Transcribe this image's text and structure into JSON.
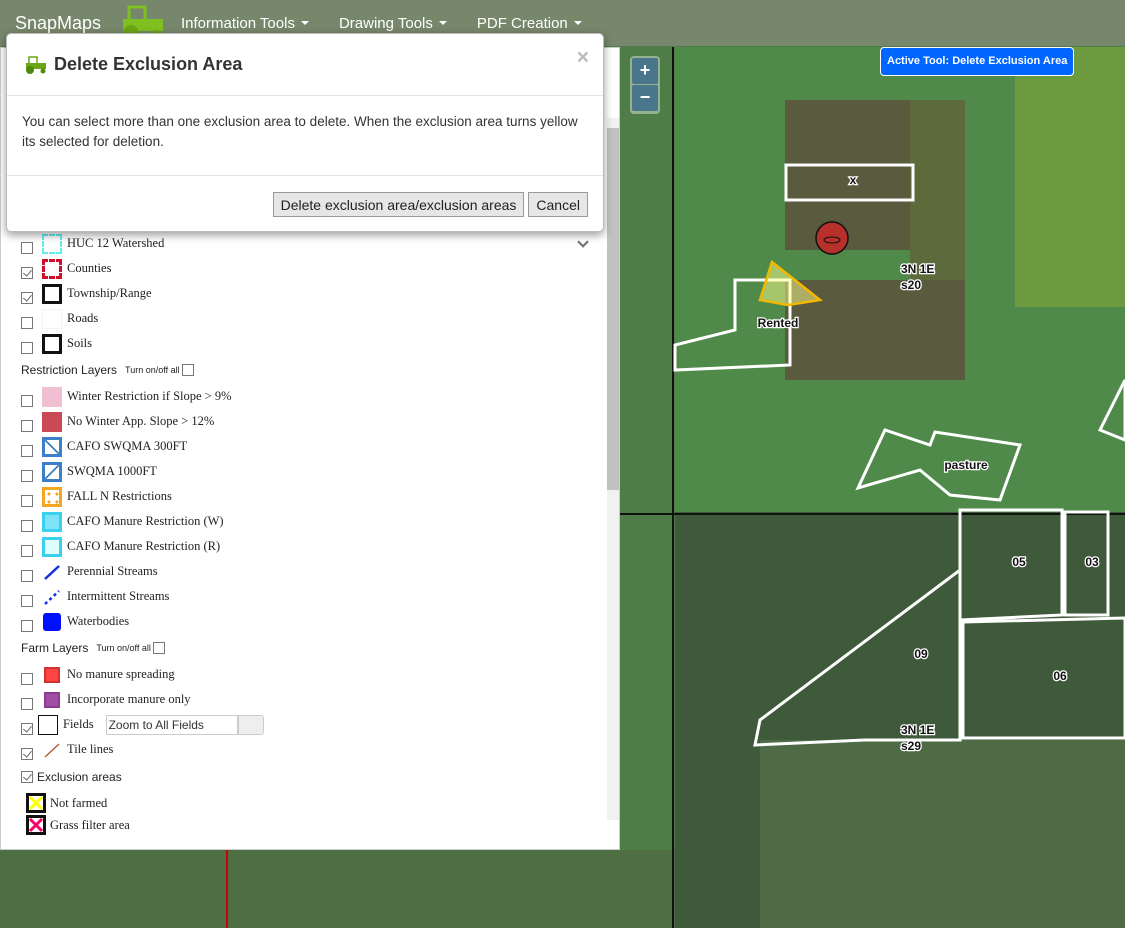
{
  "navbar": {
    "brand": "SnapMaps",
    "items": [
      {
        "label": "Information Tools"
      },
      {
        "label": "Drawing Tools"
      },
      {
        "label": "PDF Creation"
      }
    ]
  },
  "modal": {
    "title": "Delete Exclusion Area",
    "close": "×",
    "body": "You can select more than one exclusion area to delete. When the exclusion area turns yellow its selected for deletion.",
    "delete_label": "Delete exclusion area/exclusion areas",
    "cancel_label": "Cancel"
  },
  "map": {
    "zoom_in": "+",
    "zoom_out": "−",
    "active_tool": "Active Tool: Delete Exclusion Area",
    "labels": {
      "x": "x",
      "rented": "Rented",
      "twp1a": "3N 1E",
      "twp1b": "s20",
      "pasture": "pasture",
      "f05": "05",
      "f03": "03",
      "f09": "09",
      "f06": "06",
      "twp2a": "3N 1E",
      "twp2b": "s29"
    }
  },
  "base_layers": [
    {
      "label": "HUC 12 Watershed",
      "checked": false
    },
    {
      "label": "Counties",
      "checked": true
    },
    {
      "label": "Township/Range",
      "checked": true
    },
    {
      "label": "Roads",
      "checked": false
    },
    {
      "label": "Soils",
      "checked": false
    }
  ],
  "restriction": {
    "title": "Restriction Layers",
    "toggle_all": "Turn on/off all",
    "items": [
      {
        "label": "Winter Restriction if Slope > 9%",
        "checked": false
      },
      {
        "label": "No Winter App. Slope > 12%",
        "checked": false
      },
      {
        "label": "CAFO SWQMA 300FT",
        "checked": false
      },
      {
        "label": "SWQMA 1000FT",
        "checked": false
      },
      {
        "label": "FALL N Restrictions",
        "checked": false
      },
      {
        "label": "CAFO Manure Restriction (W)",
        "checked": false
      },
      {
        "label": "CAFO Manure Restriction (R)",
        "checked": false
      },
      {
        "label": "Perennial Streams",
        "checked": false
      },
      {
        "label": "Intermittent Streams",
        "checked": false
      },
      {
        "label": "Waterbodies",
        "checked": false
      }
    ]
  },
  "farm": {
    "title": "Farm Layers",
    "toggle_all": "Turn on/off all",
    "items": [
      {
        "label": "No manure spreading",
        "checked": false
      },
      {
        "label": "Incorporate manure only",
        "checked": false
      },
      {
        "label": "Fields",
        "checked": true
      },
      {
        "label": "Tile lines",
        "checked": true
      }
    ],
    "fields_select": "Zoom to All Fields"
  },
  "exclusion": {
    "title": "Exclusion areas",
    "checked": true,
    "items": [
      {
        "label": "Not farmed"
      },
      {
        "label": "Grass filter area"
      }
    ]
  },
  "colors": {
    "navbar": "#77876b",
    "active_tool": "#0066ff",
    "selected_exclusion": "#f5c518"
  }
}
